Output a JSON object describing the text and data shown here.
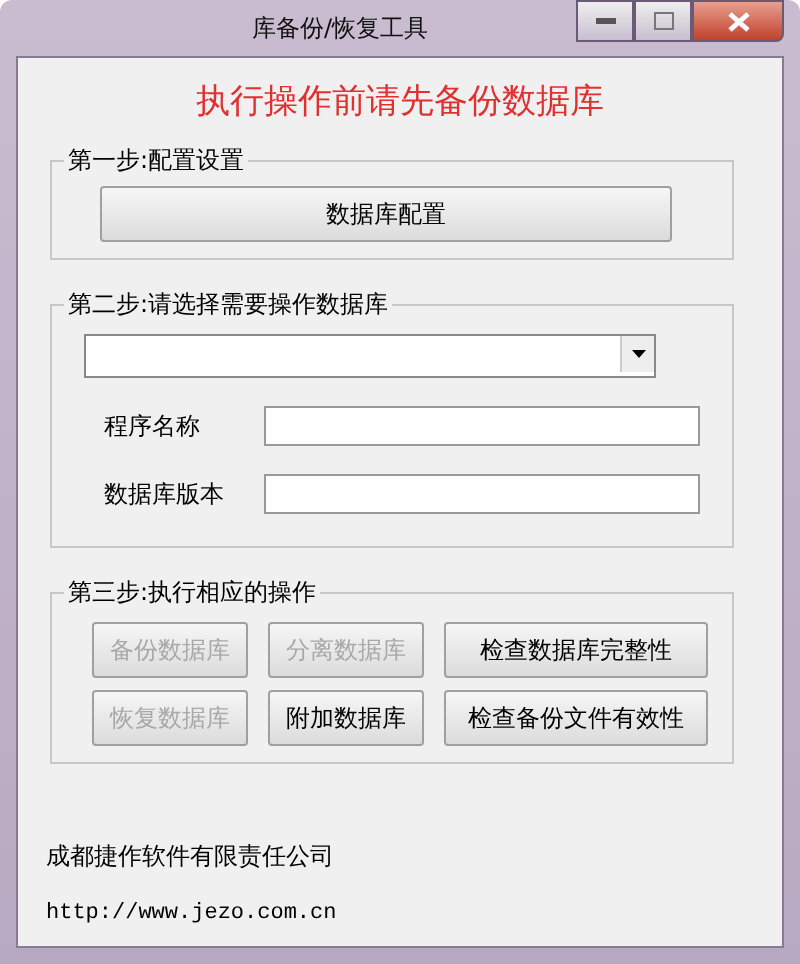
{
  "window": {
    "title": "库备份/恢复工具"
  },
  "warning": "执行操作前请先备份数据库",
  "step1": {
    "legend": "第一步:配置设置",
    "button": "数据库配置"
  },
  "step2": {
    "legend": "第二步:请选择需要操作数据库",
    "fields": [
      {
        "label": "程序名称"
      },
      {
        "label": "数据库版本"
      }
    ]
  },
  "step3": {
    "legend": "第三步:执行相应的操作",
    "buttons": [
      {
        "label": "备份数据库",
        "disabled": true
      },
      {
        "label": "分离数据库",
        "disabled": true
      },
      {
        "label": "检查数据库完整性",
        "disabled": false
      },
      {
        "label": "恢复数据库",
        "disabled": true
      },
      {
        "label": "附加数据库",
        "disabled": false
      },
      {
        "label": "检查备份文件有效性",
        "disabled": false
      }
    ]
  },
  "footer": {
    "company": "成都捷作软件有限责任公司",
    "url": "http://www.jezo.com.cn"
  }
}
